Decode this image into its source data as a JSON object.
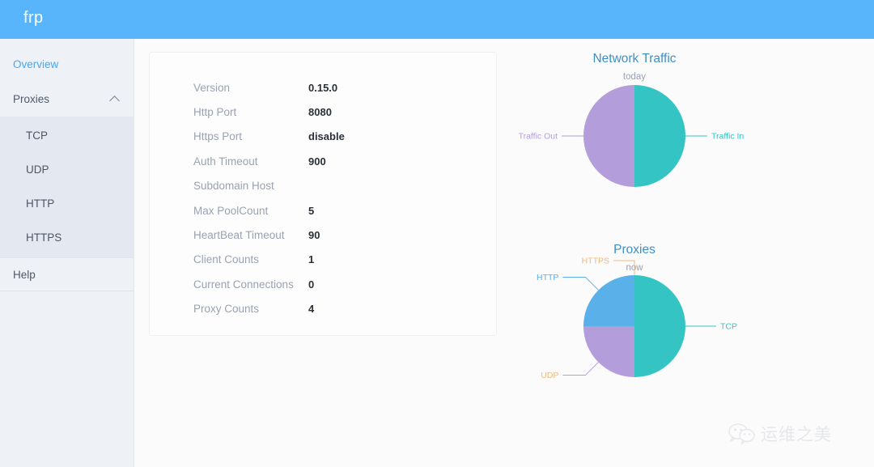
{
  "header": {
    "brand": "frp",
    "background": "#58b4fb"
  },
  "sidebar": {
    "overview": {
      "label": "Overview",
      "active": true
    },
    "group": {
      "label": "Proxies",
      "icon": "chevron-up-icon",
      "expanded": true
    },
    "sub_items": [
      {
        "label": "TCP"
      },
      {
        "label": "UDP"
      },
      {
        "label": "HTTP"
      },
      {
        "label": "HTTPS"
      }
    ],
    "help": {
      "label": "Help"
    }
  },
  "info_card": {
    "rows": [
      {
        "label": "Version",
        "value": "0.15.0"
      },
      {
        "label": "Http Port",
        "value": "8080"
      },
      {
        "label": "Https Port",
        "value": "disable"
      },
      {
        "label": "Auth Timeout",
        "value": "900"
      },
      {
        "label": "Subdomain Host",
        "value": ""
      },
      {
        "label": "Max PoolCount",
        "value": "5"
      },
      {
        "label": "HeartBeat Timeout",
        "value": "90"
      },
      {
        "label": "Client Counts",
        "value": "1"
      },
      {
        "label": "Current Connections",
        "value": "0"
      },
      {
        "label": "Proxy Counts",
        "value": "4"
      }
    ]
  },
  "chart_data": [
    {
      "type": "pie",
      "name": "network-traffic",
      "title": "Network Traffic",
      "subtitle": "today",
      "labels": [
        "Traffic Out",
        "Traffic In"
      ],
      "values": [
        50,
        50
      ],
      "colors": [
        "#b39ddb",
        "#35c4c4"
      ],
      "label_positions": [
        "left",
        "right"
      ],
      "legend": "labels-with-leader-lines",
      "radius": 63,
      "title_color": "#3f8fc4"
    },
    {
      "type": "pie",
      "name": "proxies",
      "title": "Proxies",
      "subtitle": "now",
      "labels": [
        "TCP",
        "HTTP",
        "UDP",
        "HTTPS"
      ],
      "values": [
        50,
        25,
        25,
        0
      ],
      "colors": [
        "#35c4c4",
        "#5ab0e8",
        "#b39ddb",
        "#f0b97c"
      ],
      "label_positions": [
        "right",
        "upper-left",
        "lower-left",
        "top"
      ],
      "legend": "labels-with-leader-lines",
      "radius": 63,
      "title_color": "#3f8fc4"
    }
  ],
  "watermark": {
    "icon": "wechat-icon",
    "text": "运维之美"
  }
}
